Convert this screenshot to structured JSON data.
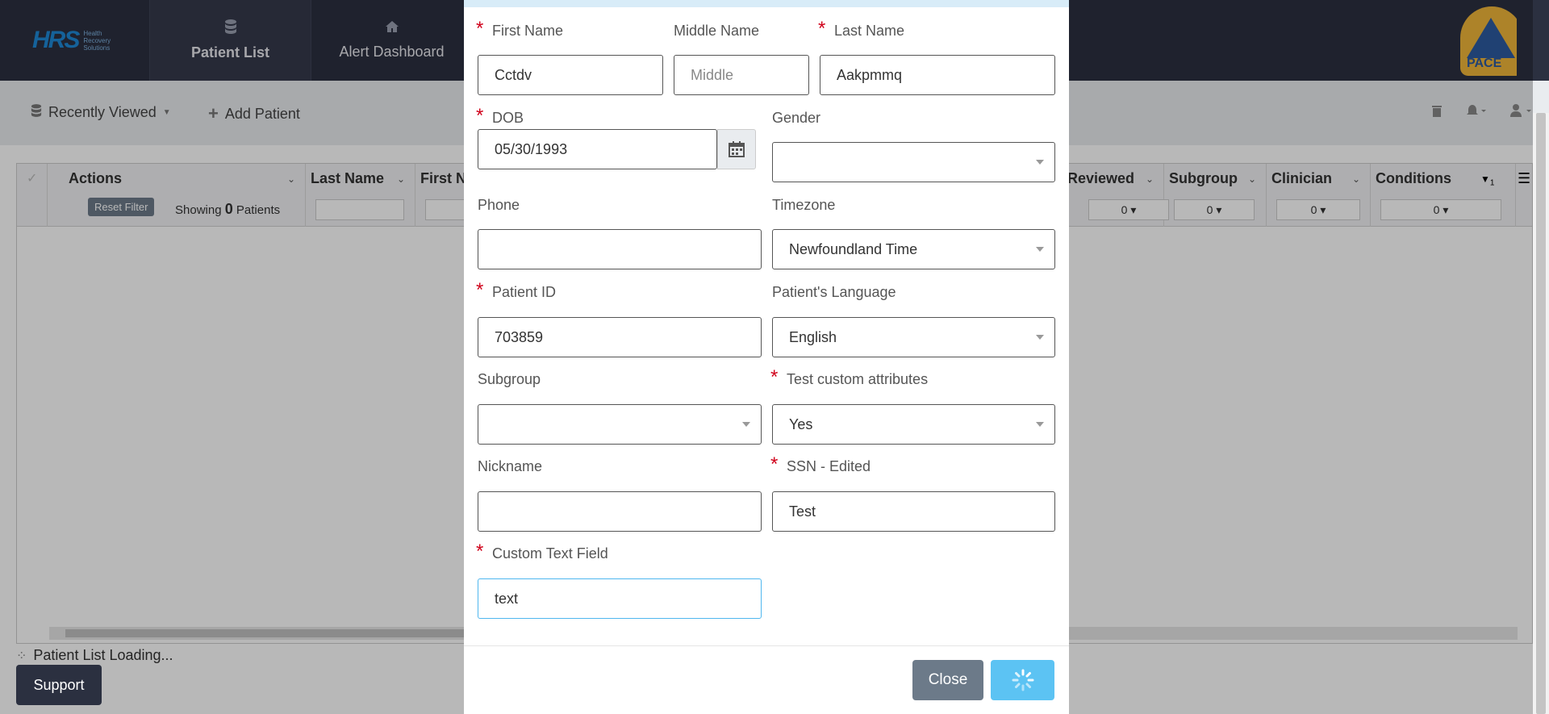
{
  "nav": {
    "logo_text": "HRS",
    "logo_sub": "Health Recovery Solutions",
    "tabs": [
      {
        "label": "Patient List",
        "icon": "database-icon"
      },
      {
        "label": "Alert Dashboard",
        "icon": "home-icon"
      }
    ],
    "brand_logo_text": "PACE"
  },
  "toolbar": {
    "recently_viewed": "Recently Viewed",
    "add_patient": "Add Patient"
  },
  "grid": {
    "reset_filter": "Reset Filter",
    "showing_prefix": "Showing",
    "showing_count": "0",
    "showing_suffix": "Patients",
    "columns": [
      {
        "title": "Actions"
      },
      {
        "title": "Last Name",
        "filter": ""
      },
      {
        "title": "First Nam",
        "filter": ""
      },
      {
        "title": "Reviewed",
        "filter": "0"
      },
      {
        "title": "Subgroup",
        "filter": "0"
      },
      {
        "title": "Clinician",
        "filter": "0"
      },
      {
        "title": "Conditions",
        "filter": "0",
        "sort_index": "1"
      }
    ],
    "loading_text": "Patient List Loading..."
  },
  "support_label": "Support",
  "form": {
    "first_name": {
      "label": "First Name",
      "value": "Cctdv"
    },
    "middle_name": {
      "label": "Middle Name",
      "placeholder": "Middle"
    },
    "last_name": {
      "label": "Last Name",
      "value": "Aakpmmq"
    },
    "dob": {
      "label": "DOB",
      "value": "05/30/1993"
    },
    "gender": {
      "label": "Gender",
      "value": ""
    },
    "phone": {
      "label": "Phone",
      "value": ""
    },
    "timezone": {
      "label": "Timezone",
      "value": "Newfoundland Time"
    },
    "patient_id": {
      "label": "Patient ID",
      "value": "703859"
    },
    "language": {
      "label": "Patient's Language",
      "value": "English"
    },
    "subgroup": {
      "label": "Subgroup",
      "value": ""
    },
    "custom_attr": {
      "label": "Test custom attributes",
      "value": "Yes"
    },
    "nickname": {
      "label": "Nickname",
      "value": ""
    },
    "ssn": {
      "label": "SSN - Edited",
      "value": "Test"
    },
    "custom_text": {
      "label": "Custom Text Field",
      "value": "text"
    }
  },
  "buttons": {
    "close": "Close"
  }
}
